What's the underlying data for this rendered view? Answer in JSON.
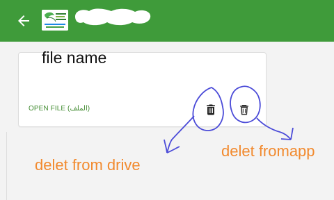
{
  "appbar": {
    "color": "#3f9b3a",
    "back_icon": "arrow-left-icon",
    "logo_icon": "app-logo"
  },
  "card": {
    "file_name": "file name",
    "open_file_label": "OPEN FILE (الملف)",
    "delete_drive_icon": "trash-icon",
    "delete_app_icon": "trash-icon"
  },
  "annotations": {
    "color": "#f28a2e",
    "ink_color": "#4b4bd8",
    "delete_from_drive": "delet from drive",
    "delete_from_app": "delet fromapp"
  }
}
